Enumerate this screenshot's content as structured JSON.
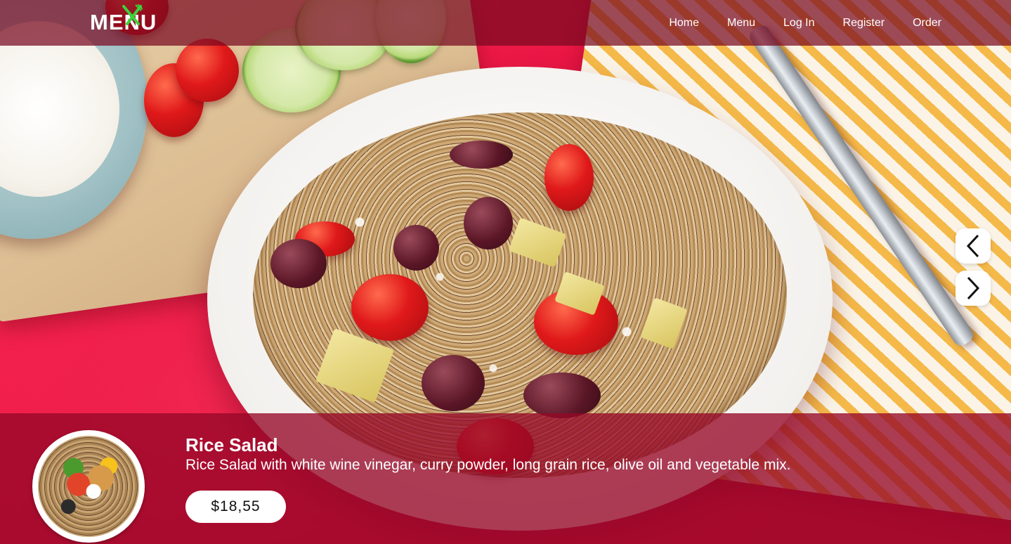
{
  "brand": {
    "logo_left": "ME",
    "logo_mid": "N",
    "logo_right": "U",
    "logo_icon": "fork-knife-icon",
    "accent_color": "#3cd23c"
  },
  "nav": {
    "items": [
      {
        "label": "Home"
      },
      {
        "label": "Menu"
      },
      {
        "label": "Log In"
      },
      {
        "label": "Register"
      },
      {
        "label": "Order"
      }
    ]
  },
  "carousel": {
    "prev_icon": "chevron-left-icon",
    "next_icon": "chevron-right-icon"
  },
  "dish": {
    "name": "Rice Salad",
    "description": "Rice Salad with white wine vinegar, curry powder, long grain rice, olive oil and vegetable mix.",
    "price": "$18,55"
  },
  "colors": {
    "navbar_bg": "#780820",
    "info_bg": "#96082a",
    "hero_bg": "#e8123f"
  }
}
